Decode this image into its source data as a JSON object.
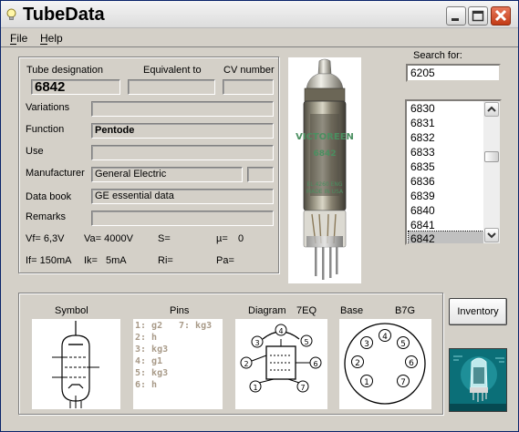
{
  "window": {
    "title": "TubeData",
    "icons": {
      "app": "lightbulb-icon",
      "minimize": "minimize-icon",
      "maximize": "maximize-icon",
      "close": "close-icon"
    }
  },
  "menu": {
    "file": "File",
    "help": "Help"
  },
  "form": {
    "labels": {
      "tube_designation": "Tube designation",
      "equivalent_to": "Equivalent to",
      "cv_number": "CV number",
      "variations": "Variations",
      "function": "Function",
      "use": "Use",
      "manufacturer": "Manufacturer",
      "data_book": "Data book",
      "remarks": "Remarks"
    },
    "values": {
      "tube_designation": "6842",
      "equivalent_to": "",
      "cv_number": "",
      "variations": "",
      "function": "Pentode",
      "use": "",
      "manufacturer": "General Electric",
      "manufacturer_extra": "",
      "data_book": "GE essential data",
      "remarks": ""
    },
    "params": {
      "vf": "Vf= 6,3V",
      "va": "Va= 4000V",
      "s": "S=",
      "mu": "µ=",
      "mu_value": "0",
      "if": "If= 150mA",
      "ik": "Ik=",
      "ik_value": "5mA",
      "ri": "Ri=",
      "pa": "Pa="
    }
  },
  "photo": {
    "name": "vacuum-tube-photo",
    "print_top": "VICTOREEN",
    "print_mid": "6842",
    "print_low1": "EL.4260 ENG",
    "print_low2": "MADE IN USA"
  },
  "search": {
    "label": "Search for:",
    "value": "6205",
    "list": [
      "6830",
      "6831",
      "6832",
      "6833",
      "6835",
      "6836",
      "6839",
      "6840",
      "6841",
      "6842"
    ],
    "selected": "6842"
  },
  "bottom": {
    "symbol_label": "Symbol",
    "pins_label": "Pins",
    "diagram_label": "Diagram",
    "diagram_code": "7EQ",
    "base_label": "Base",
    "base_code": "B7G",
    "pins_list": [
      "1: g2",
      "2: h",
      "3: kg3",
      "4: g1",
      "5: kg3",
      "6: h",
      "7: kg3"
    ],
    "diagram_pins": [
      "1",
      "2",
      "3",
      "4",
      "5",
      "6",
      "7"
    ],
    "base_pins": [
      "1",
      "2",
      "3",
      "4",
      "5",
      "6",
      "7"
    ]
  },
  "inventory_label": "Inventory",
  "colors": {
    "face": "#d4d0c8",
    "title_close": "#c23a15",
    "pins_text": "#a89a88",
    "logo_bg": "#0b6f78"
  }
}
